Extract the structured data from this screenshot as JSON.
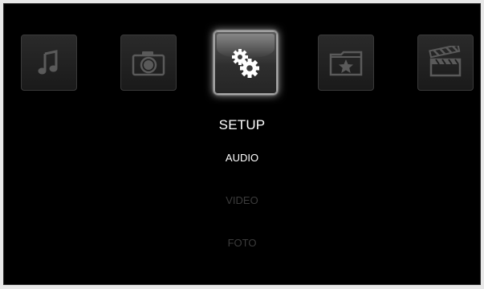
{
  "top_menu": {
    "tiles": [
      {
        "icon": "music-note-icon",
        "selected": false
      },
      {
        "icon": "camera-icon",
        "selected": false
      },
      {
        "icon": "gears-icon",
        "selected": true
      },
      {
        "icon": "star-folder-icon",
        "selected": false
      },
      {
        "icon": "clapperboard-icon",
        "selected": false
      }
    ]
  },
  "submenu": {
    "title": "SETUP",
    "items": [
      {
        "label": "AUDIO",
        "active": true
      },
      {
        "label": "VIDEO",
        "active": false
      },
      {
        "label": "FOTO",
        "active": false
      }
    ]
  },
  "colors": {
    "background": "#000000",
    "active_text": "#ffffff",
    "inactive_text": "#3c3c3c",
    "icon_dim": "#5a5a5a",
    "icon_bright": "#ffffff"
  }
}
